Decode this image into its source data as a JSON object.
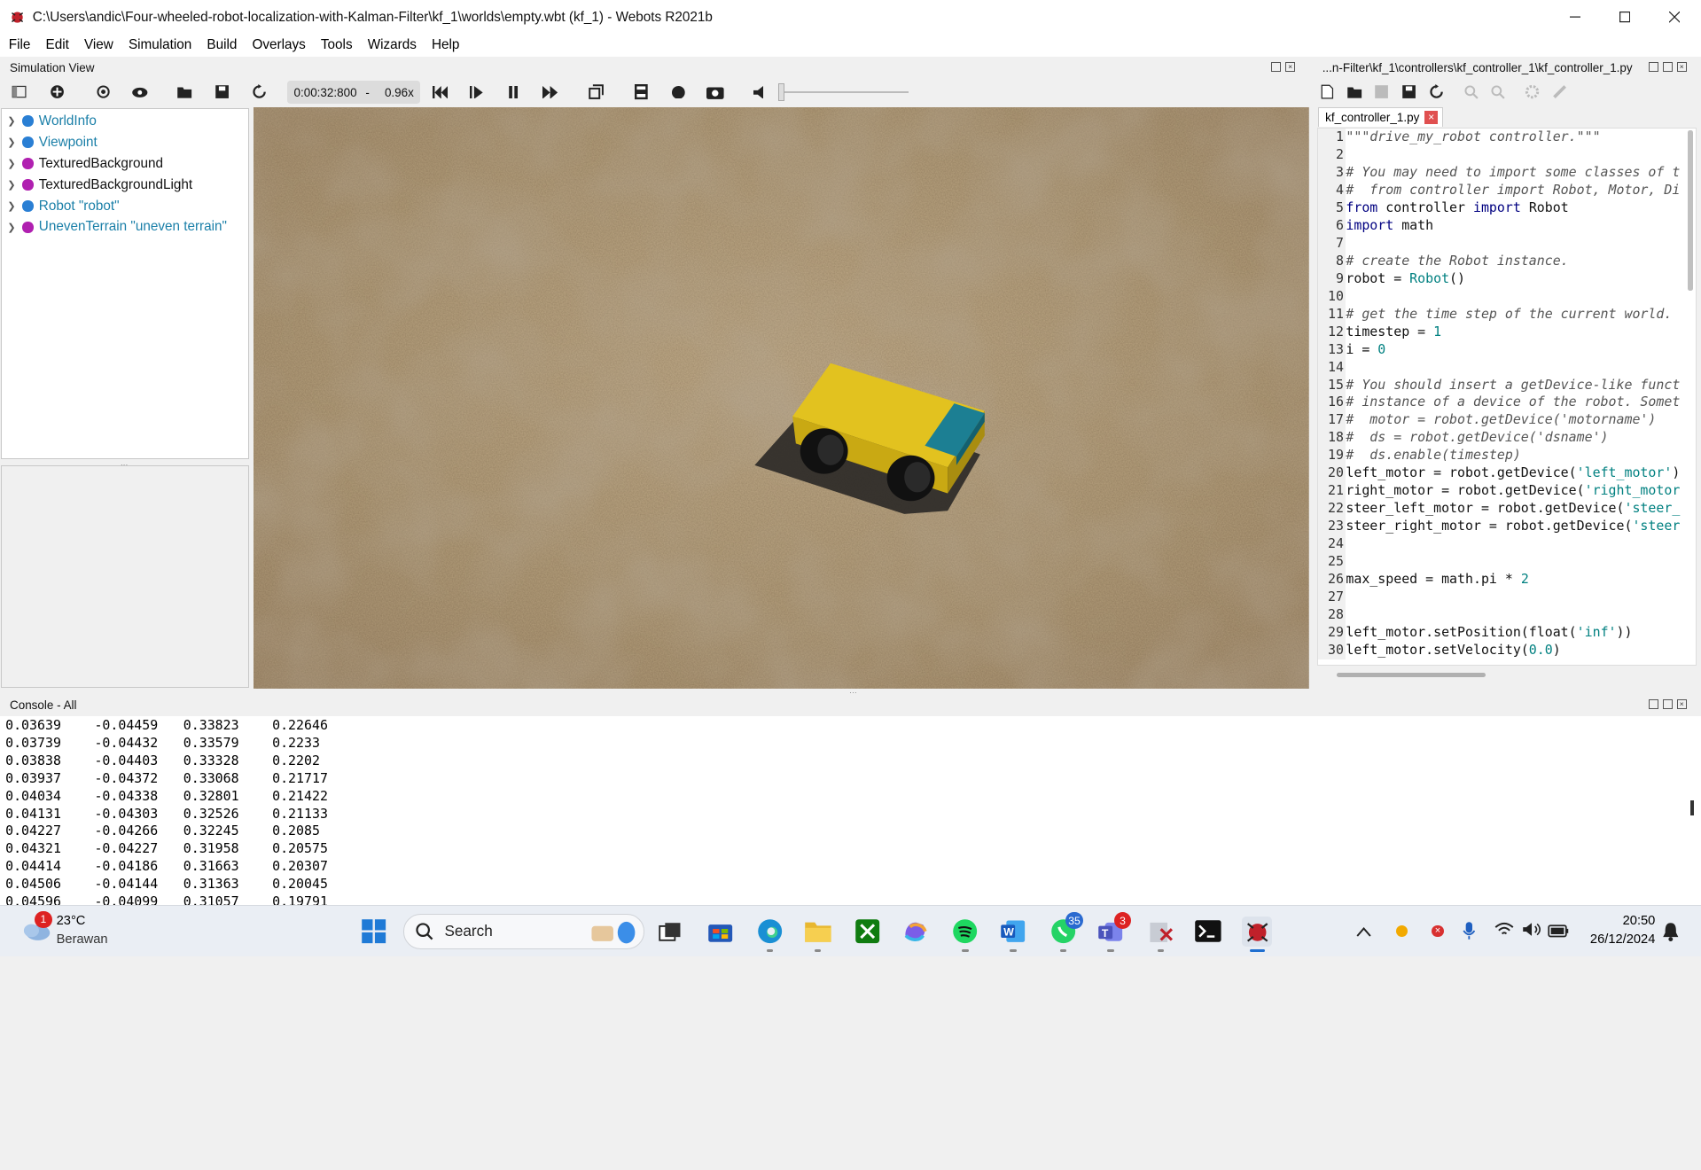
{
  "window": {
    "title": "C:\\Users\\andic\\Four-wheeled-robot-localization-with-Kalman-Filter\\kf_1\\worlds\\empty.wbt (kf_1) - Webots R2021b"
  },
  "menu": [
    "File",
    "Edit",
    "View",
    "Simulation",
    "Build",
    "Overlays",
    "Tools",
    "Wizards",
    "Help"
  ],
  "simulation_view": {
    "title": "Simulation View",
    "time": "0:00:32:800",
    "separator": "-",
    "speed": "0.96x"
  },
  "scene_tree": [
    {
      "label": "WorldInfo",
      "color": "#1a7fa8",
      "dot": "#2a7fd4"
    },
    {
      "label": "Viewpoint",
      "color": "#1a7fa8",
      "dot": "#2a7fd4"
    },
    {
      "label": "TexturedBackground",
      "color": "#111111",
      "dot": "#b020b0"
    },
    {
      "label": "TexturedBackgroundLight",
      "color": "#111111",
      "dot": "#b020b0"
    },
    {
      "label": "Robot \"robot\"",
      "color": "#1a7fa8",
      "dot": "#2a7fd4"
    },
    {
      "label": "UnevenTerrain \"uneven terrain\"",
      "color": "#1a7fa8",
      "dot": "#b020b0"
    }
  ],
  "editor": {
    "path": "...n-Filter\\kf_1\\controllers\\kf_controller_1\\kf_controller_1.py",
    "tab": "kf_controller_1.py",
    "lines": [
      {
        "n": "1",
        "t": "\"\"\"drive_my_robot controller.\"\"\"",
        "c": "cm"
      },
      {
        "n": "2",
        "t": "",
        "c": ""
      },
      {
        "n": "3",
        "t": "# You may need to import some classes of t",
        "c": "cm"
      },
      {
        "n": "4",
        "t": "#  from controller import Robot, Motor, Di",
        "c": "cm"
      },
      {
        "n": "5",
        "t": "from controller import Robot",
        "c": "kwline"
      },
      {
        "n": "6",
        "t": "import math",
        "c": "kwline2"
      },
      {
        "n": "7",
        "t": "",
        "c": ""
      },
      {
        "n": "8",
        "t": "# create the Robot instance.",
        "c": "cm"
      },
      {
        "n": "9",
        "t": "robot = Robot()",
        "c": "robot"
      },
      {
        "n": "10",
        "t": "",
        "c": ""
      },
      {
        "n": "11",
        "t": "# get the time step of the current world.",
        "c": "cm"
      },
      {
        "n": "12",
        "t": "timestep = 1",
        "c": "num"
      },
      {
        "n": "13",
        "t": "i = 0",
        "c": "num"
      },
      {
        "n": "14",
        "t": "",
        "c": ""
      },
      {
        "n": "15",
        "t": "# You should insert a getDevice-like funct",
        "c": "cm"
      },
      {
        "n": "16",
        "t": "# instance of a device of the robot. Somet",
        "c": "cm"
      },
      {
        "n": "17",
        "t": "#  motor = robot.getDevice('motorname')",
        "c": "cm"
      },
      {
        "n": "18",
        "t": "#  ds = robot.getDevice('dsname')",
        "c": "cm"
      },
      {
        "n": "19",
        "t": "#  ds.enable(timestep)",
        "c": "cm"
      },
      {
        "n": "20",
        "t": "left_motor = robot.getDevice('left_motor')",
        "c": "str"
      },
      {
        "n": "21",
        "t": "right_motor = robot.getDevice('right_motor",
        "c": "str"
      },
      {
        "n": "22",
        "t": "steer_left_motor = robot.getDevice('steer_",
        "c": "str"
      },
      {
        "n": "23",
        "t": "steer_right_motor = robot.getDevice('steer",
        "c": "str"
      },
      {
        "n": "24",
        "t": "",
        "c": ""
      },
      {
        "n": "25",
        "t": "",
        "c": ""
      },
      {
        "n": "26",
        "t": "max_speed = math.pi * 2",
        "c": "num"
      },
      {
        "n": "27",
        "t": "",
        "c": ""
      },
      {
        "n": "28",
        "t": "",
        "c": ""
      },
      {
        "n": "29",
        "t": "left_motor.setPosition(float('inf'))",
        "c": "str"
      },
      {
        "n": "30",
        "t": "left_motor.setVelocity(0.0)",
        "c": "num"
      }
    ]
  },
  "console": {
    "title": "Console - All",
    "rows": [
      [
        "0.03639",
        "-0.04459",
        "0.33823",
        "0.22646"
      ],
      [
        "0.03739",
        "-0.04432",
        "0.33579",
        "0.2233"
      ],
      [
        "0.03838",
        "-0.04403",
        "0.33328",
        "0.2202"
      ],
      [
        "0.03937",
        "-0.04372",
        "0.33068",
        "0.21717"
      ],
      [
        "0.04034",
        "-0.04338",
        "0.32801",
        "0.21422"
      ],
      [
        "0.04131",
        "-0.04303",
        "0.32526",
        "0.21133"
      ],
      [
        "0.04227",
        "-0.04266",
        "0.32245",
        "0.2085"
      ],
      [
        "0.04321",
        "-0.04227",
        "0.31958",
        "0.20575"
      ],
      [
        "0.04414",
        "-0.04186",
        "0.31663",
        "0.20307"
      ],
      [
        "0.04506",
        "-0.04144",
        "0.31363",
        "0.20045"
      ],
      [
        "0.04596",
        "-0.04099",
        "0.31057",
        "0.19791"
      ]
    ]
  },
  "taskbar": {
    "weather_temp": "23°C",
    "weather_desc": "Berawan",
    "weather_badge": "1",
    "search_placeholder": "Search",
    "whatsapp_badge": "35",
    "teams_badge": "3",
    "time": "20:50",
    "date": "26/12/2024"
  },
  "colors": {
    "robot_body": "#e2c21f",
    "robot_panel": "#1c7f93",
    "terrain": "#b49e7c"
  }
}
